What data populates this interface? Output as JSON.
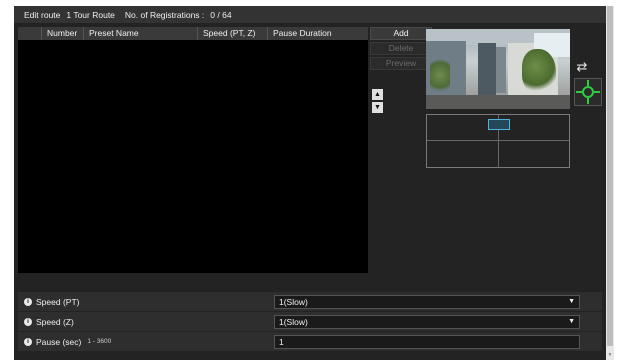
{
  "header": {
    "edit_route_label": "Edit route",
    "route_name": "1 Tour Route",
    "registrations_label": "No. of Registrations :",
    "registrations_value": "0 / 64"
  },
  "table": {
    "columns": [
      "",
      "Number",
      "Preset Name",
      "Speed (PT, Z)",
      "Pause Duration"
    ],
    "rows": []
  },
  "buttons": {
    "add": "Add",
    "delete": "Delete",
    "preview": "Preview"
  },
  "arrows": {
    "up": "▲",
    "down": "▼"
  },
  "camera_controls": {
    "swap": "⇄"
  },
  "settings": {
    "speed_pt": {
      "label": "Speed (PT)",
      "value": "1(Slow)"
    },
    "speed_z": {
      "label": "Speed (Z)",
      "value": "1(Slow)"
    },
    "pause": {
      "label": "Pause (sec)",
      "range": "1 - 3600",
      "value": "1"
    }
  },
  "icons": {
    "info": "i",
    "caret": "▼"
  },
  "colors": {
    "background": "#232323",
    "accent_green": "#2ecc40",
    "marker_blue": "#4fb3d9"
  }
}
